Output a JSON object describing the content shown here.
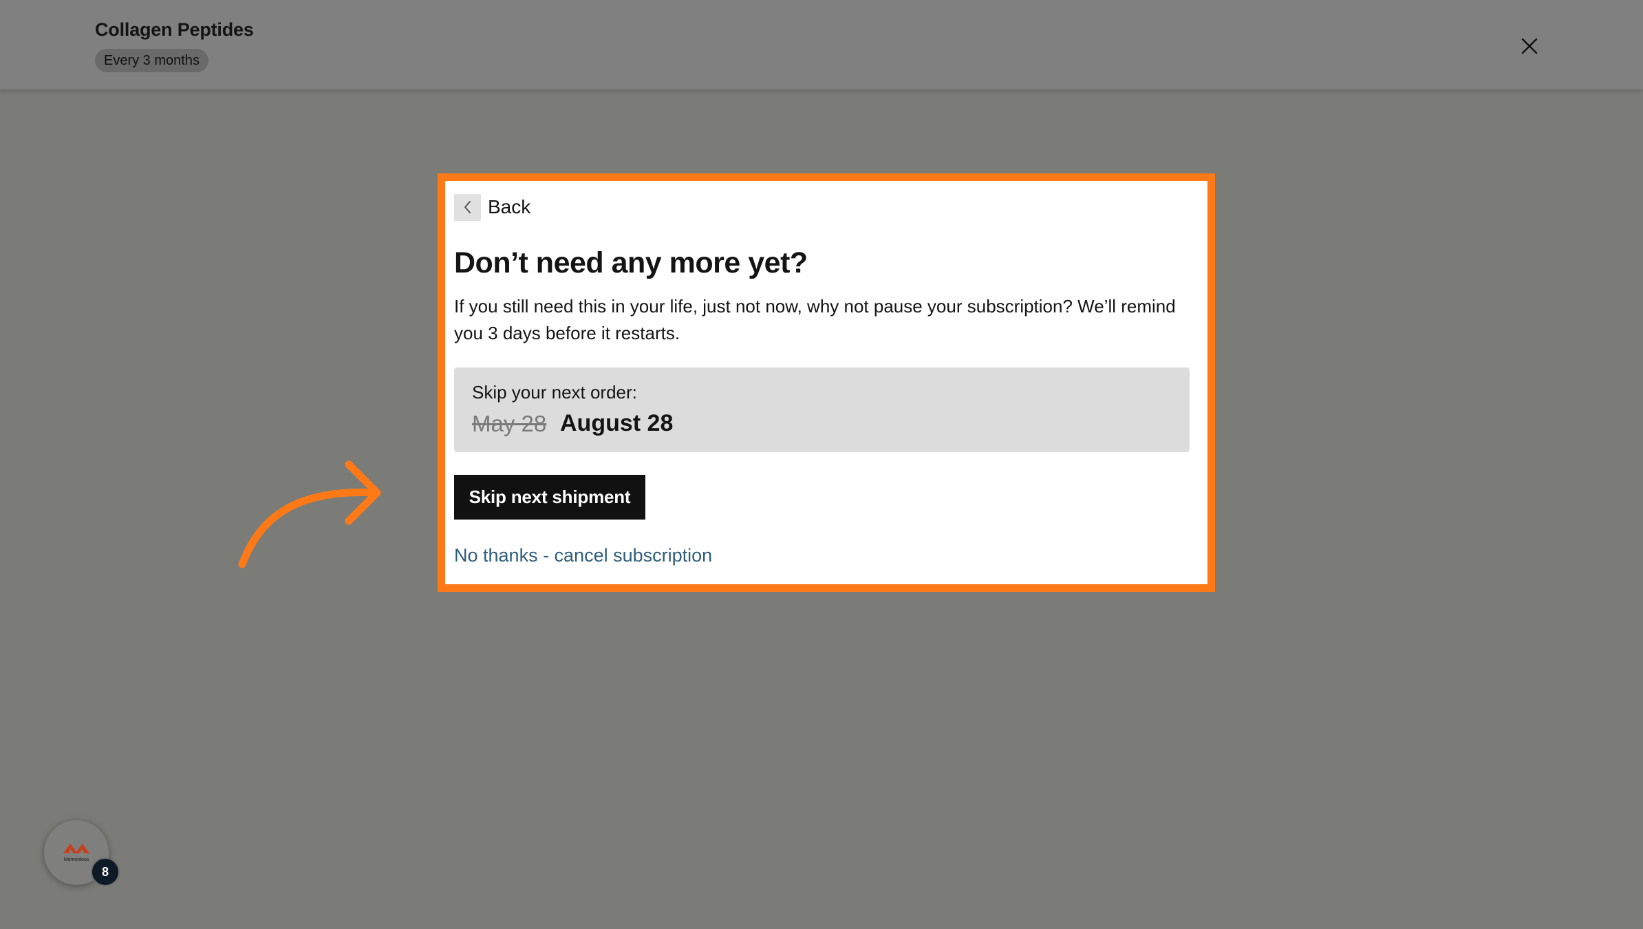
{
  "header": {
    "product_title": "Collagen Peptides",
    "frequency": "Every 3 months"
  },
  "modal": {
    "back_label": "Back",
    "heading": "Don’t need any more yet?",
    "body": "If you still need this in your life, just not now, why not pause your subscription? We’ll remind you 3 days before it restarts.",
    "skip_box": {
      "label": "Skip your next order:",
      "old_date": "May 28",
      "new_date": "August 28"
    },
    "skip_button_label": "Skip next shipment",
    "cancel_link_label": "No thanks - cancel subscription"
  },
  "widget": {
    "logo_text": "Momentous",
    "badge_count": "8"
  },
  "colors": {
    "highlight": "#ff7a17",
    "link": "#2f5d7a",
    "overlay": "#7b7b78"
  }
}
